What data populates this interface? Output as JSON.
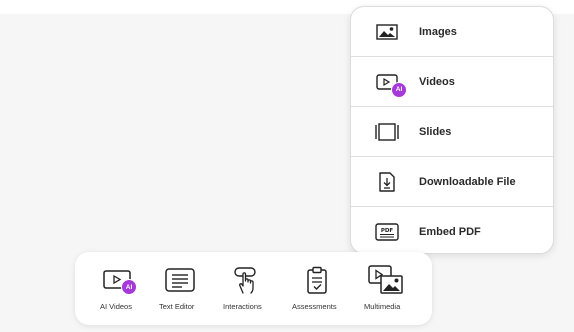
{
  "menu": {
    "items": [
      {
        "label": "Images",
        "icon": "image-icon"
      },
      {
        "label": "Videos",
        "icon": "ai-video-icon",
        "badge": "AI"
      },
      {
        "label": "Slides",
        "icon": "slides-icon"
      },
      {
        "label": "Downloadable File",
        "icon": "download-file-icon"
      },
      {
        "label": "Embed PDF",
        "icon": "pdf-icon",
        "icon_text": "PDF"
      }
    ]
  },
  "toolbar": {
    "items": [
      {
        "label": "AI Videos",
        "icon": "ai-video-icon",
        "badge": "AI"
      },
      {
        "label": "Text Editor",
        "icon": "text-editor-icon"
      },
      {
        "label": "Interactions",
        "icon": "interaction-hand-icon"
      },
      {
        "label": "Assessments",
        "icon": "clipboard-check-icon"
      },
      {
        "label": "Multimedia",
        "icon": "multimedia-icon"
      }
    ]
  },
  "colors": {
    "ai_badge": "#a63ad8",
    "canvas": "#f6f6f6"
  }
}
